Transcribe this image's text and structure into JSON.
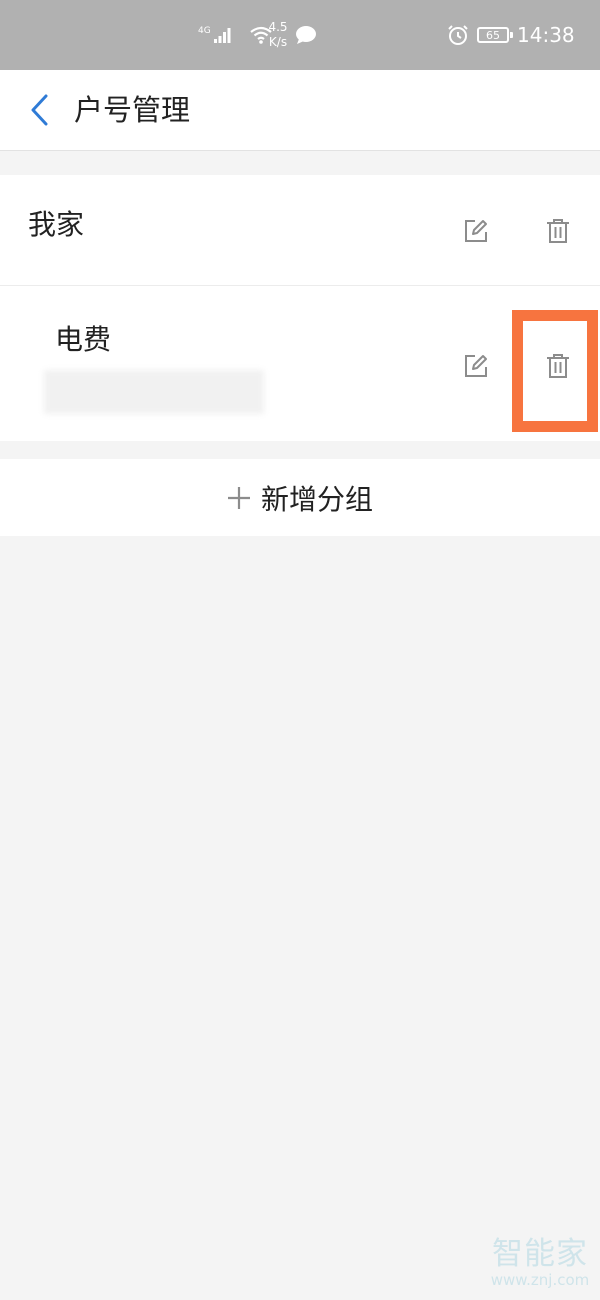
{
  "status_bar": {
    "network_type": "4G",
    "net_speed_value": "4.5",
    "net_speed_unit": "K/s",
    "battery_level": "65",
    "time": "14:38"
  },
  "header": {
    "title": "户号管理",
    "icon": "chevron-left-icon"
  },
  "groups": [
    {
      "name": "我家",
      "edit_icon": "edit-icon",
      "delete_icon": "trash-icon",
      "accounts": [
        {
          "name": "电费"
        }
      ]
    }
  ],
  "add_group": {
    "icon": "plus-icon",
    "label": "新增分组"
  },
  "watermark": {
    "brand": "智能家",
    "url": "www.znj.com"
  },
  "colors": {
    "accent": "#2f7bd6",
    "highlight": "#f7743f",
    "status_bar_bg": "#b1b1b1",
    "page_bg": "#f4f4f4"
  }
}
